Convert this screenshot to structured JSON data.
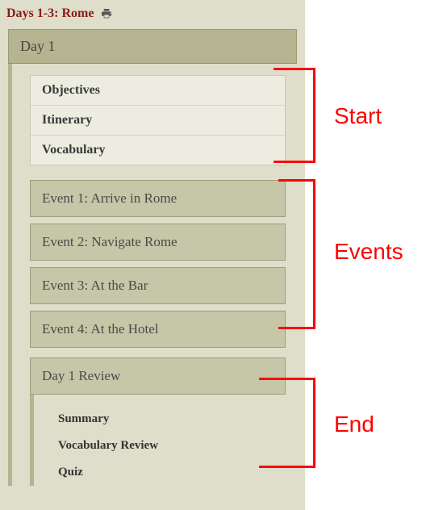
{
  "title": "Days 1-3: Rome",
  "day": {
    "label": "Day 1",
    "start": [
      {
        "label": "Objectives"
      },
      {
        "label": "Itinerary"
      },
      {
        "label": "Vocabulary"
      }
    ],
    "events": [
      {
        "label": "Event 1: Arrive in Rome"
      },
      {
        "label": "Event 2: Navigate Rome"
      },
      {
        "label": "Event 3: At the Bar"
      },
      {
        "label": "Event 4: At the Hotel"
      }
    ],
    "review": {
      "label": "Day 1 Review",
      "end": [
        {
          "label": "Summary"
        },
        {
          "label": "Vocabulary Review"
        },
        {
          "label": "Quiz"
        }
      ]
    }
  },
  "annotations": {
    "start": "Start",
    "events": "Events",
    "end": "End"
  }
}
